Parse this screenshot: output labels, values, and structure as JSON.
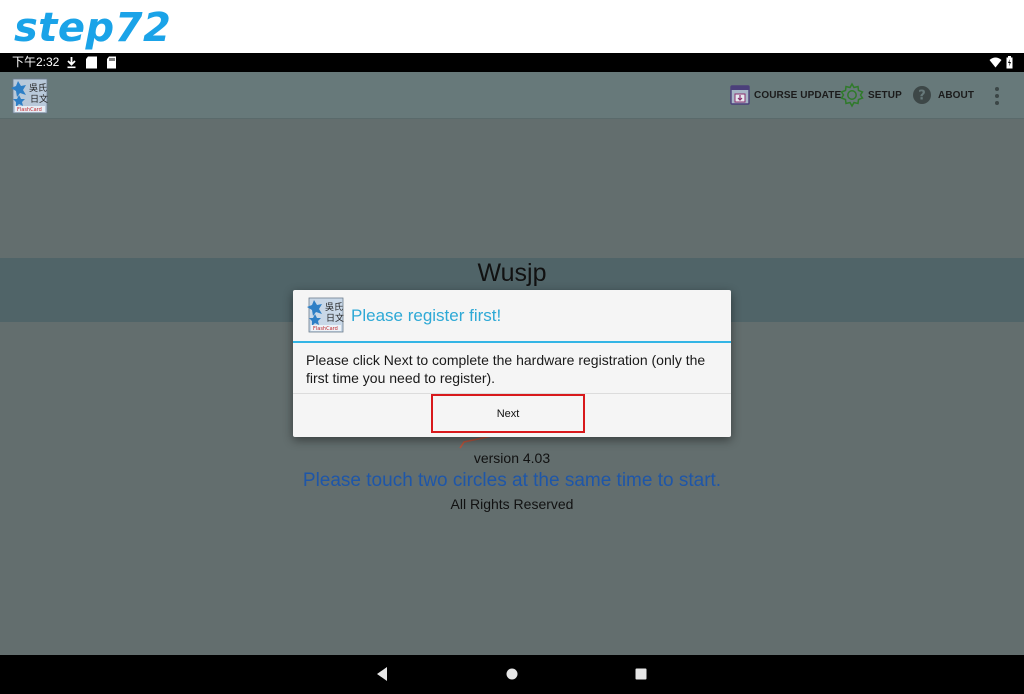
{
  "step_label": "step72",
  "status_bar": {
    "time": "下午2:32"
  },
  "app_bar": {
    "actions": [
      {
        "label": "COURSE UPDATE",
        "icon": "course-update-icon"
      },
      {
        "label": "SETUP",
        "icon": "gear-icon"
      },
      {
        "label": "ABOUT",
        "icon": "help-icon"
      }
    ]
  },
  "main": {
    "title": "Wusjp",
    "version": "version 4.03",
    "touch_hint": "Please touch two circles at the same time to start.",
    "rights": "All Rights Reserved"
  },
  "dialog": {
    "title": "Please register first!",
    "message": "Please click Next to complete the hardware registration (only the first time you need to register).",
    "next_label": "Next"
  },
  "colors": {
    "accent": "#33b5e5",
    "dialog_title": "#2ea9d6",
    "highlight": "#d8191c",
    "step_label": "#1aa3e8",
    "hint_text": "#1e56a8"
  }
}
